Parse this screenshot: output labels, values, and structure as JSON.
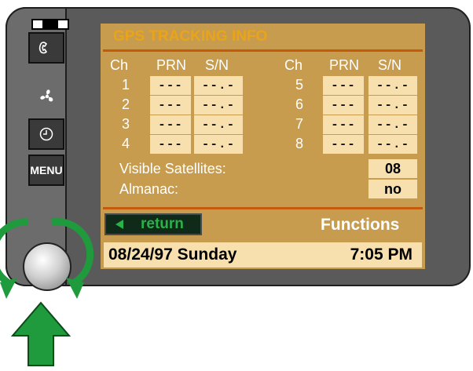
{
  "screen": {
    "title": "GPS TRACKING INFO",
    "headers": {
      "ch": "Ch",
      "prn": "PRN",
      "sn": "S/N"
    },
    "channels_left": [
      {
        "ch": "1",
        "prn": "---",
        "sn": "--.-"
      },
      {
        "ch": "2",
        "prn": "---",
        "sn": "--.-"
      },
      {
        "ch": "3",
        "prn": "---",
        "sn": "--.-"
      },
      {
        "ch": "4",
        "prn": "---",
        "sn": "--.-"
      }
    ],
    "channels_right": [
      {
        "ch": "5",
        "prn": "---",
        "sn": "--.-"
      },
      {
        "ch": "6",
        "prn": "---",
        "sn": "--.-"
      },
      {
        "ch": "7",
        "prn": "---",
        "sn": "--.-"
      },
      {
        "ch": "8",
        "prn": "---",
        "sn": "--.-"
      }
    ],
    "visible_satellites_label": "Visible Satellites:",
    "visible_satellites_value": "08",
    "almanac_label": "Almanac:",
    "almanac_value": "no",
    "return_label": "return",
    "functions_label": "Functions",
    "date": "08/24/97  Sunday",
    "time": "7:05 PM"
  },
  "sidebar": {
    "menu_label": "MENU",
    "icons": [
      "phone-icon",
      "fan-icon",
      "clock-icon",
      "knob-icon"
    ]
  },
  "colors": {
    "screen_bg": "#c79c4e",
    "title": "#e9a419",
    "cell_bg": "#f7dfae",
    "accent_green": "#29b14a",
    "separator": "#c45a0a"
  }
}
